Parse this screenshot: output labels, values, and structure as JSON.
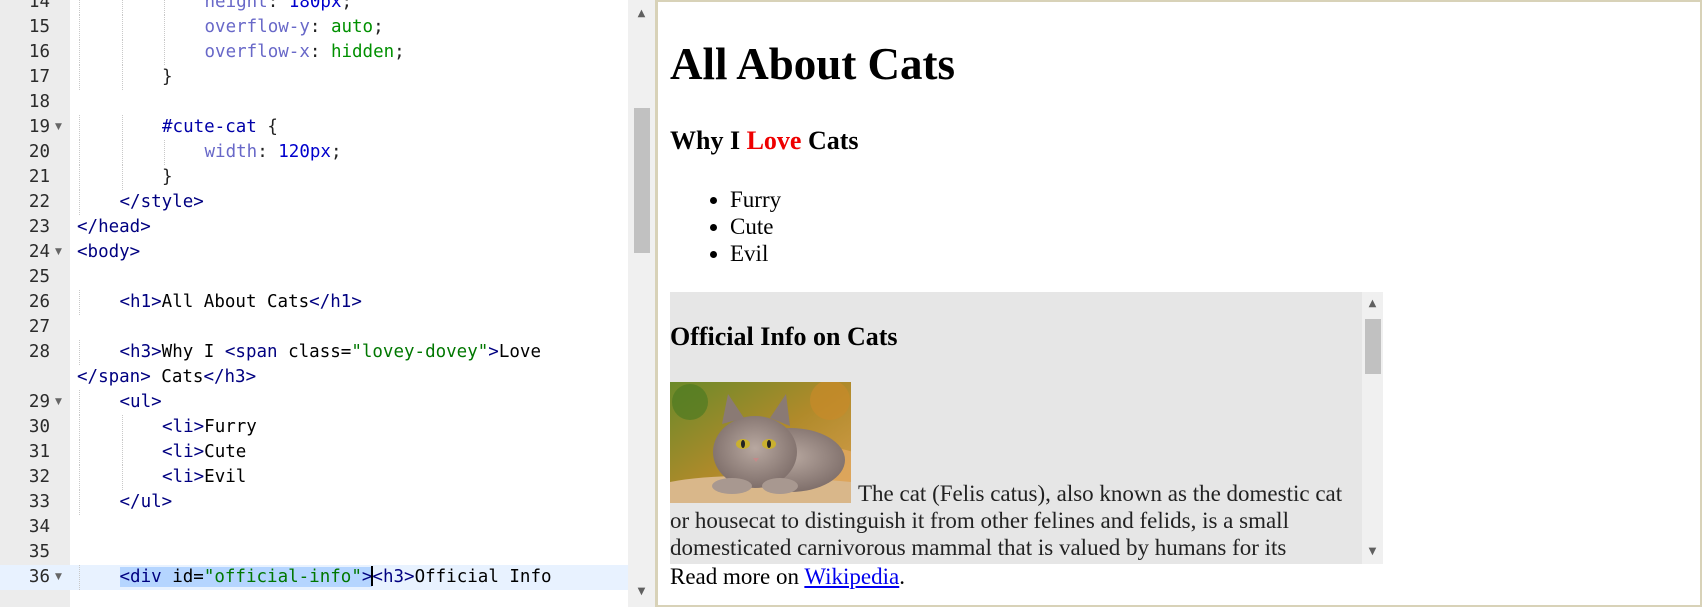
{
  "editor": {
    "lines": [
      {
        "num": "14",
        "fold": false,
        "indent": 3,
        "tokens": [
          {
            "t": "prop",
            "v": "height"
          },
          {
            "t": "pun",
            "v": ": "
          },
          {
            "t": "num",
            "v": "180px"
          },
          {
            "t": "pun",
            "v": ";"
          }
        ]
      },
      {
        "num": "15",
        "fold": false,
        "indent": 3,
        "tokens": [
          {
            "t": "prop",
            "v": "overflow-y"
          },
          {
            "t": "pun",
            "v": ": "
          },
          {
            "t": "cval",
            "v": "auto"
          },
          {
            "t": "pun",
            "v": ";"
          }
        ]
      },
      {
        "num": "16",
        "fold": false,
        "indent": 3,
        "tokens": [
          {
            "t": "prop",
            "v": "overflow-x"
          },
          {
            "t": "pun",
            "v": ": "
          },
          {
            "t": "cval",
            "v": "hidden"
          },
          {
            "t": "pun",
            "v": ";"
          }
        ]
      },
      {
        "num": "17",
        "fold": false,
        "indent": 2,
        "tokens": [
          {
            "t": "pun",
            "v": "}"
          }
        ]
      },
      {
        "num": "18",
        "fold": false,
        "indent": 0,
        "tokens": []
      },
      {
        "num": "19",
        "fold": true,
        "indent": 2,
        "tokens": [
          {
            "t": "sel",
            "v": "#cute-cat"
          },
          {
            "t": "pun",
            "v": " {"
          }
        ]
      },
      {
        "num": "20",
        "fold": false,
        "indent": 3,
        "tokens": [
          {
            "t": "prop",
            "v": "width"
          },
          {
            "t": "pun",
            "v": ": "
          },
          {
            "t": "num",
            "v": "120px"
          },
          {
            "t": "pun",
            "v": ";"
          }
        ]
      },
      {
        "num": "21",
        "fold": false,
        "indent": 2,
        "tokens": [
          {
            "t": "pun",
            "v": "}"
          }
        ]
      },
      {
        "num": "22",
        "fold": false,
        "indent": 1,
        "tokens": [
          {
            "t": "tag",
            "v": "</style>"
          }
        ]
      },
      {
        "num": "23",
        "fold": false,
        "indent": 0,
        "tokens": [
          {
            "t": "tag",
            "v": "</head>"
          }
        ]
      },
      {
        "num": "24",
        "fold": true,
        "indent": 0,
        "tokens": [
          {
            "t": "tag",
            "v": "<body>"
          }
        ]
      },
      {
        "num": "25",
        "fold": false,
        "indent": 0,
        "tokens": []
      },
      {
        "num": "26",
        "fold": false,
        "indent": 1,
        "tokens": [
          {
            "t": "tag",
            "v": "<h1>"
          },
          {
            "t": "txt",
            "v": "All About Cats"
          },
          {
            "t": "tag",
            "v": "</h1>"
          }
        ]
      },
      {
        "num": "27",
        "fold": false,
        "indent": 0,
        "tokens": []
      },
      {
        "num": "28",
        "fold": false,
        "indent": 1,
        "tokens": [
          {
            "t": "tag",
            "v": "<h3>"
          },
          {
            "t": "txt",
            "v": "Why I "
          },
          {
            "t": "tag",
            "v": "<span"
          },
          {
            "t": "attr",
            "v": " class="
          },
          {
            "t": "val",
            "v": "\"lovey-dovey\""
          },
          {
            "t": "tag",
            "v": ">"
          },
          {
            "t": "txt",
            "v": "Love"
          }
        ]
      },
      {
        "num": "",
        "fold": false,
        "indent": 0,
        "tokens": [
          {
            "t": "tag",
            "v": "</span>"
          },
          {
            "t": "txt",
            "v": " Cats"
          },
          {
            "t": "tag",
            "v": "</h3>"
          }
        ]
      },
      {
        "num": "29",
        "fold": true,
        "indent": 1,
        "tokens": [
          {
            "t": "tag",
            "v": "<ul>"
          }
        ]
      },
      {
        "num": "30",
        "fold": false,
        "indent": 2,
        "tokens": [
          {
            "t": "tag",
            "v": "<li>"
          },
          {
            "t": "txt",
            "v": "Furry"
          }
        ]
      },
      {
        "num": "31",
        "fold": false,
        "indent": 2,
        "tokens": [
          {
            "t": "tag",
            "v": "<li>"
          },
          {
            "t": "txt",
            "v": "Cute"
          }
        ]
      },
      {
        "num": "32",
        "fold": false,
        "indent": 2,
        "tokens": [
          {
            "t": "tag",
            "v": "<li>"
          },
          {
            "t": "txt",
            "v": "Evil"
          }
        ]
      },
      {
        "num": "33",
        "fold": false,
        "indent": 1,
        "tokens": [
          {
            "t": "tag",
            "v": "</ul>"
          }
        ]
      },
      {
        "num": "34",
        "fold": false,
        "indent": 0,
        "tokens": []
      },
      {
        "num": "35",
        "fold": false,
        "indent": 0,
        "tokens": []
      },
      {
        "num": "36",
        "fold": true,
        "indent": 1,
        "active": true,
        "tokens": [
          {
            "t": "tag",
            "v": "<div",
            "sel": true
          },
          {
            "t": "attr",
            "v": " id=",
            "sel": true
          },
          {
            "t": "val",
            "v": "\"official-info\"",
            "sel": true
          },
          {
            "t": "tag",
            "v": ">",
            "sel": true
          },
          {
            "t": "caret",
            "v": ""
          },
          {
            "t": "tag",
            "v": "<h3>"
          },
          {
            "t": "txt",
            "v": "Official Info"
          }
        ]
      }
    ],
    "scrollbar": {
      "up_arrow": "▲",
      "down_arrow": "▼"
    }
  },
  "preview": {
    "h1": "All About Cats",
    "h3": {
      "before": "Why I ",
      "love": "Love",
      "after": " Cats"
    },
    "list": [
      "Furry",
      "Cute",
      "Evil"
    ],
    "info": {
      "heading": "Official Info on Cats",
      "image_alt": "cute cat photo",
      "text": "The cat (Felis catus), also known as the domestic cat or housecat to distinguish it from other felines and felids, is a small domesticated carnivorous mammal that is valued by humans for its",
      "scroll_up": "▲",
      "scroll_down": "▼"
    },
    "read_more": {
      "prefix": "Read more on ",
      "link": "Wikipedia",
      "suffix": "."
    },
    "colors": {
      "love": "#ee0000",
      "link": "#0000ee",
      "info_bg": "#e6e6e6"
    }
  }
}
